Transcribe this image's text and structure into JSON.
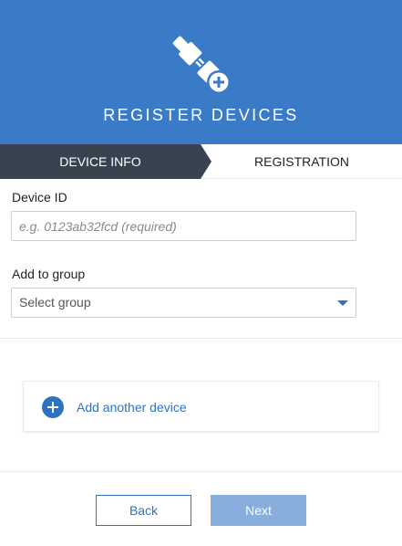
{
  "header": {
    "title": "REGISTER DEVICES",
    "icon": "plug-add-icon",
    "background_color": "#3a7bc8"
  },
  "steps": [
    {
      "label": "DEVICE INFO",
      "active": true
    },
    {
      "label": "REGISTRATION",
      "active": false
    }
  ],
  "form": {
    "device_id": {
      "label": "Device ID",
      "placeholder": "e.g. 0123ab32fcd (required)",
      "value": ""
    },
    "group": {
      "label": "Add to group",
      "selected": "Select group"
    }
  },
  "add_device": {
    "label": "Add another device",
    "icon": "plus-circle-icon"
  },
  "footer": {
    "back_label": "Back",
    "next_label": "Next"
  },
  "colors": {
    "accent": "#2e72c2",
    "step_active_bg": "#38434f",
    "next_disabled": "#87aedc"
  }
}
